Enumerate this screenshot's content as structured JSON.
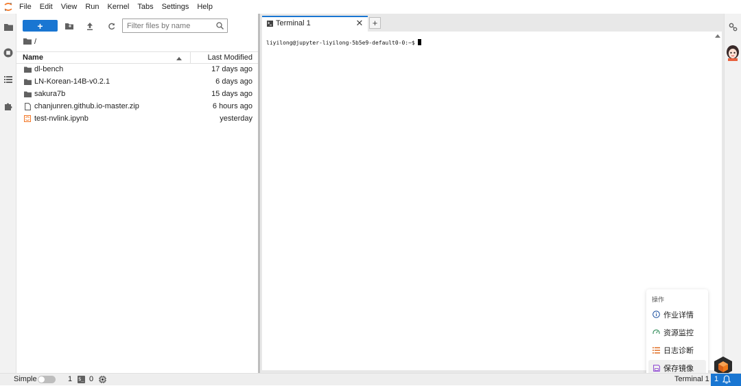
{
  "menubar": {
    "items": [
      "File",
      "Edit",
      "View",
      "Run",
      "Kernel",
      "Tabs",
      "Settings",
      "Help"
    ]
  },
  "leftbar": {
    "icons": [
      "folder-icon",
      "running-icon",
      "toc-icon",
      "extension-icon"
    ]
  },
  "filebrowser": {
    "new_label": "+",
    "filter_placeholder": "Filter files by name",
    "breadcrumb": "/",
    "columns": {
      "name": "Name",
      "modified": "Last Modified"
    },
    "files": [
      {
        "name": "dl-bench",
        "type": "folder",
        "modified": "17 days ago"
      },
      {
        "name": "LN-Korean-14B-v0.2.1",
        "type": "folder",
        "modified": "6 days ago"
      },
      {
        "name": "sakura7b",
        "type": "folder",
        "modified": "15 days ago"
      },
      {
        "name": "chanjunren.github.io-master.zip",
        "type": "file",
        "modified": "6 hours ago"
      },
      {
        "name": "test-nvlink.ipynb",
        "type": "notebook",
        "modified": "yesterday"
      }
    ]
  },
  "tabs": {
    "active": {
      "label": "Terminal 1",
      "close": "✕"
    },
    "add": "+"
  },
  "terminal": {
    "prompt": "liyilong@jupyter-liyilong-5b5e9-default0-0:~$"
  },
  "action_panel": {
    "title": "操作",
    "items": [
      {
        "label": "作业详情",
        "icon": "info-icon",
        "color": "#1a4fa0"
      },
      {
        "label": "资源监控",
        "icon": "gauge-icon",
        "color": "#2e8b57"
      },
      {
        "label": "日志诊断",
        "icon": "log-list-icon",
        "color": "#e06b1f"
      },
      {
        "label": "保存镜像",
        "icon": "save-icon",
        "color": "#8a3fd1"
      }
    ]
  },
  "statusbar": {
    "simple_label": "Simple",
    "terminals_count": "1",
    "kernels_count": "0",
    "active_label": "Terminal 1",
    "notifications": "1"
  },
  "colors": {
    "accent": "#1976d2",
    "notebook_icon": "#f37726"
  }
}
